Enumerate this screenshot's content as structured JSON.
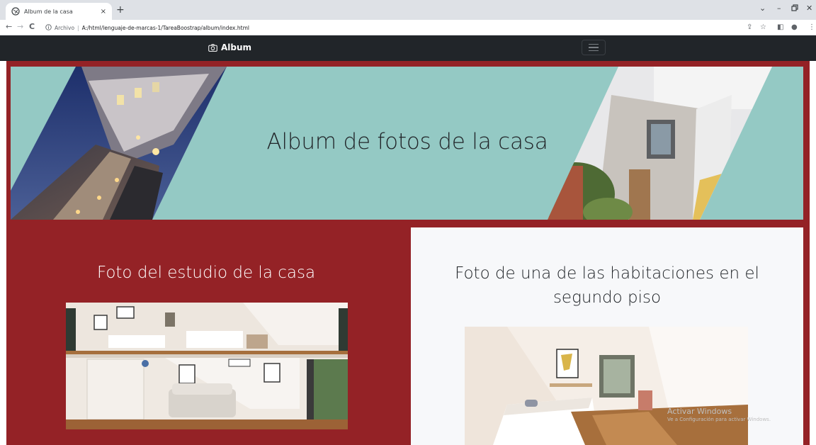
{
  "browser": {
    "tab_title": "Album de la casa",
    "tab_close": "×",
    "new_tab": "+",
    "window_controls": {
      "menu": "⌄",
      "minimize": "–",
      "maximize": "🗗",
      "close": "✕"
    },
    "nav": {
      "back": "←",
      "forward": "→",
      "reload": "C"
    },
    "security_label": "Archivo",
    "separator": "|",
    "url": "A:/html/lenguaje-de-marcas-1/TareaBoostrap/album/index.html",
    "tools": {
      "share": "⇪",
      "bookmark": "☆",
      "sidepanel": "◧",
      "profile": "●",
      "menu": "⋮"
    }
  },
  "navbar": {
    "brand": "Album"
  },
  "hero": {
    "title": "Album de fotos de la casa"
  },
  "cards": {
    "left_title": "Foto del estudio de la casa",
    "right_title": "Foto de una de las habitaciones en el segundo piso"
  },
  "watermark": {
    "line1": "Activar Windows",
    "line2": "Ve a Configuración para activar Windows."
  },
  "colors": {
    "page_bg": "#942226",
    "hero_bg": "#94c9c4",
    "navbar_bg": "#212529",
    "card_right_bg": "#f7f8fa"
  }
}
